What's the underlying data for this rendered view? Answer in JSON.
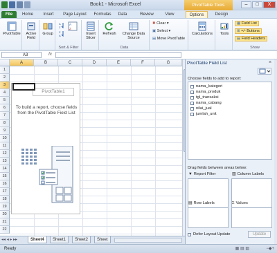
{
  "window": {
    "title": "Book1 - Microsoft Excel",
    "context_tab": "PivotTable Tools",
    "controls": [
      "–",
      "□",
      "X"
    ]
  },
  "tabs": [
    "File",
    "Home",
    "Insert",
    "Page Layout",
    "Formulas",
    "Data",
    "Review",
    "View",
    "Options",
    "Design"
  ],
  "ribbon": {
    "groups": {
      "pivottable": "",
      "group": "",
      "sort_filter": "Sort & Filter",
      "data": "Data",
      "actions": "",
      "calculations": "",
      "tools": "",
      "show": "Show"
    },
    "buttons": {
      "pivottable": "PivotTable",
      "active_field": "Active Field",
      "group": "Group",
      "insert_slicer": "Insert Slicer",
      "refresh": "Refresh",
      "change_data_source": "Change Data Source",
      "clear": "Clear",
      "select": "Select",
      "move_pivottable": "Move PivotTable",
      "calculations": "Calculations",
      "tools": "Tools",
      "field_list": "Field List",
      "plus_minus_buttons": "+/- Buttons",
      "field_headers": "Field Headers"
    }
  },
  "namebox": {
    "value": "A3"
  },
  "formula_bar": {
    "fx": "fx",
    "value": ""
  },
  "grid": {
    "columns": [
      "A",
      "B",
      "C",
      "D",
      "E",
      "F",
      "G"
    ],
    "rows": [
      "1",
      "2",
      "3",
      "4",
      "5",
      "6",
      "7",
      "8",
      "9",
      "10",
      "11",
      "12",
      "13",
      "14",
      "15",
      "16",
      "17",
      "18",
      "19",
      "20",
      "21",
      "22"
    ],
    "selected_column": "A",
    "selected_row": "3"
  },
  "pivot_placeholder": {
    "name": "PivotTable1",
    "message": "To build a report, choose fields from the PivotTable Field List"
  },
  "sheets": [
    "Sheet4",
    "Sheet1",
    "Sheet2",
    "Sheet"
  ],
  "active_sheet": "Sheet4",
  "status": {
    "text": "Ready"
  },
  "field_list": {
    "title": "PivotTable Field List",
    "close": "×",
    "choose_label": "Choose fields to add to report:",
    "fields": [
      "nama_kategori",
      "nama_produk",
      "tgl_transaksi",
      "nama_cabang",
      "nilai_jual",
      "jumlah_unit"
    ],
    "drag_label": "Drag fields between areas below:",
    "areas": {
      "report_filter": "Report Filter",
      "column_labels": "Column Labels",
      "row_labels": "Row Labels",
      "values": "Values"
    },
    "defer_label": "Defer Layout Update",
    "update_button": "Update"
  },
  "colors": {
    "file_tab": "#2f7d32",
    "context_tab": "#e7a933",
    "selection_header": "#f3c45c",
    "highlight_button": "#fde68d"
  }
}
